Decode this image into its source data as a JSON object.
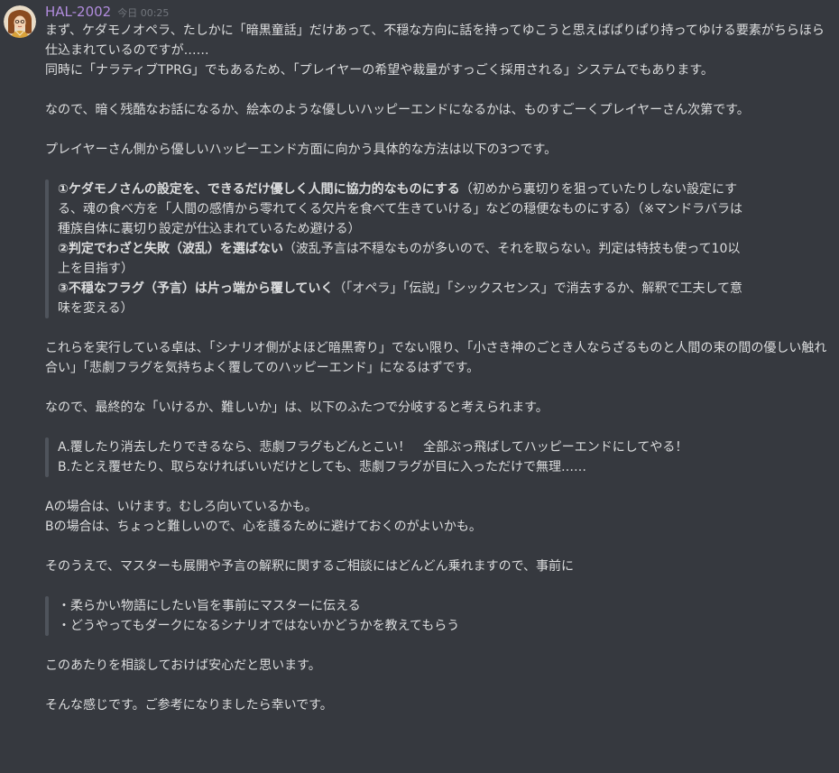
{
  "author": {
    "name": "HAL-2002",
    "timestamp": "今日 00:25",
    "color": "#b18cdd"
  },
  "message": {
    "intro": [
      "まず、ケダモノオペラ、たしかに「暗黒童話」だけあって、不穏な方向に話を持ってゆこうと思えばぱりぱり持ってゆける要素がちらほら仕込まれているのですが……",
      "同時に「ナラティブTPRG」でもあるため、「プレイヤーの希望や裁量がすっごく採用される」システムでもあります。"
    ],
    "p2": "なので、暗く残酷なお話になるか、絵本のような優しいハッピーエンドになるかは、ものすごーくプレイヤーさん次第です。",
    "p3": "プレイヤーさん側から優しいハッピーエンド方面に向かう具体的な方法は以下の3つです。",
    "methods": [
      {
        "bold": "①ケダモノさんの設定を、できるだけ優しく人間に協力的なものにする",
        "rest": "（初めから裏切りを狙っていたりしない設定にする、魂の食べ方を「人間の感情から零れてくる欠片を食べて生きていける」などの穏便なものにする）（※マンドラバラは種族自体に裏切り設定が仕込まれているため避ける）"
      },
      {
        "bold": "②判定でわざと失敗（波乱）を選ばない",
        "rest": "（波乱予言は不穏なものが多いので、それを取らない。判定は特技も使って10以上を目指す）"
      },
      {
        "bold": "③不穏なフラグ（予言）は片っ端から覆していく",
        "rest": "（「オペラ」「伝説」「シックスセンス」で消去するか、解釈で工夫して意味を変える）"
      }
    ],
    "p4": "これらを実行している卓は、「シナリオ側がよほど暗黒寄り」でない限り、「小さき神のごとき人ならざるものと人間の束の間の優しい触れ合い」「悲劇フラグを気持ちよく覆してのハッピーエンド」になるはずです。",
    "p5": "なので、最終的な「いけるか、難しいか」は、以下のふたつで分岐すると考えられます。",
    "cases": [
      "A.覆したり消去したりできるなら、悲劇フラグもどんとこい！　全部ぶっ飛ばしてハッピーエンドにしてやる！",
      "B.たとえ覆せたり、取らなければいいだけとしても、悲劇フラグが目に入っただけで無理……"
    ],
    "p6": [
      "Aの場合は、いけます。むしろ向いているかも。",
      "Bの場合は、ちょっと難しいので、心を護るために避けておくのがよいかも。"
    ],
    "p7": "そのうえで、マスターも展開や予言の解釈に関するご相談にはどんどん乗れますので、事前に",
    "tips": [
      "・柔らかい物語にしたい旨を事前にマスターに伝える",
      "・どうやってもダークになるシナリオではないかどうかを教えてもらう"
    ],
    "p8": "このあたりを相談しておけば安心だと思います。",
    "p9": "そんな感じです。ご参考になりましたら幸いです。"
  }
}
